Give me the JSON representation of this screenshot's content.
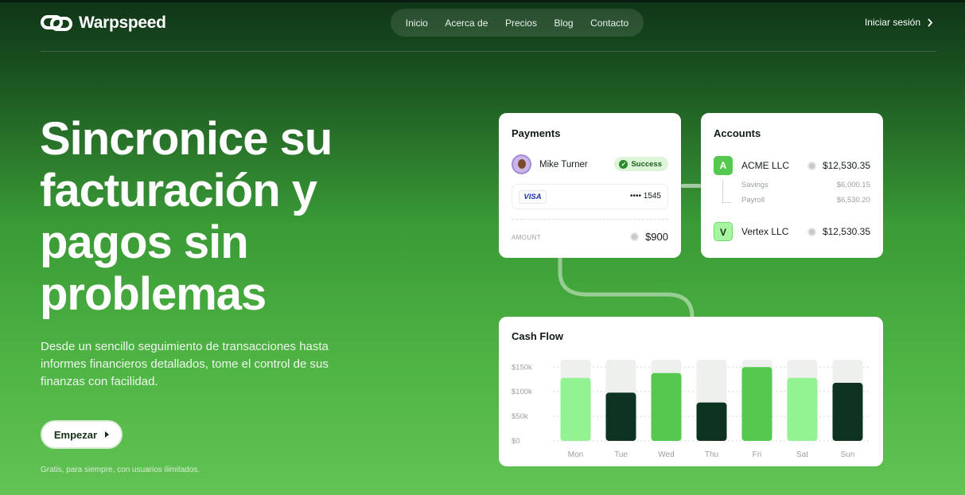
{
  "brand": {
    "name": "Warpspeed"
  },
  "nav": {
    "items": [
      "Inicio",
      "Acerca de",
      "Precios",
      "Blog",
      "Contacto"
    ],
    "login": "Iniciar sesión"
  },
  "hero": {
    "title": "Sincronice su facturación y pagos sin problemas",
    "subtitle": "Desde un sencillo seguimiento de transacciones hasta informes financieros detallados, tome el control de sus finanzas con facilidad.",
    "cta": "Empezar",
    "note": "Gratis, para siempre, con usuarios ilimitados."
  },
  "payments": {
    "title": "Payments",
    "user": "Mike Turner",
    "status": "Success",
    "card_brand": "VISA",
    "card_number": "•••• 1545",
    "amount_label": "AMOUNT",
    "amount": "$900"
  },
  "accounts": {
    "title": "Accounts",
    "items": [
      {
        "letter": "A",
        "name": "ACME LLC",
        "value": "$12,530.35"
      },
      {
        "letter": "V",
        "name": "Vertex LLC",
        "value": "$12,530.35"
      }
    ],
    "sub_items": [
      {
        "name": "Savings",
        "value": "$6,000.15"
      },
      {
        "name": "Payroll",
        "value": "$6,530.20"
      }
    ]
  },
  "colors": {
    "accent_light": "#93f291",
    "accent_mid": "#55c94f",
    "accent_dark": "#0f3321",
    "track": "#eef0ee"
  },
  "chart_data": {
    "type": "bar",
    "title": "Cash Flow",
    "categories": [
      "Mon",
      "Tue",
      "Wed",
      "Thu",
      "Fri",
      "Sat",
      "Sun"
    ],
    "values": [
      128,
      98,
      138,
      78,
      150,
      128,
      118
    ],
    "max_track": 165,
    "bar_colors": [
      "#93f291",
      "#0f3321",
      "#55c94f",
      "#0f3321",
      "#55c94f",
      "#93f291",
      "#0f3321"
    ],
    "y_ticks": [
      {
        "value": 150,
        "label": "$150k"
      },
      {
        "value": 100,
        "label": "$100k"
      },
      {
        "value": 50,
        "label": "$50k"
      },
      {
        "value": 0,
        "label": "$0"
      }
    ],
    "ylim": [
      0,
      165
    ],
    "grid": true
  }
}
